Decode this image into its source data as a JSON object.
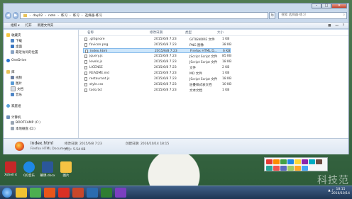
{
  "address": {
    "back_glyph": "◀",
    "forward_glyph": "▶",
    "crumbs": [
      "day02",
      "note",
      "练习",
      "练习",
      "选择器-练习"
    ],
    "search_placeholder": "搜索 选择器-练习",
    "refresh_glyph": "↻"
  },
  "toolbar": {
    "organize": "组织 ▾",
    "open": "打开",
    "new_folder": "新建文件夹"
  },
  "window_controls": {
    "min": "–",
    "max": "□",
    "close": "✕"
  },
  "nav": {
    "favorites": "收藏夹",
    "downloads": "下载",
    "desktop": "桌面",
    "recent": "最近访问的位置",
    "onedrive": "OneDrive",
    "libraries": "库",
    "videos": "视频",
    "pictures": "图片",
    "documents": "文档",
    "music": "音乐",
    "homegroup": "家庭组",
    "computer": "计算机",
    "bootcamp": "BOOTCAMP (C:)",
    "local_disk": "本地磁盘 (D:)"
  },
  "columns": {
    "name": "名称",
    "date": "修改日期",
    "type": "类型",
    "size": "大小"
  },
  "files": [
    {
      "name": ".gitignore",
      "date": "2015/6/8 7:23",
      "type": "GITIGNORE 文件",
      "size": "1 KB"
    },
    {
      "name": "favicon.png",
      "date": "2015/6/8 7:23",
      "type": "PNG 图像",
      "size": "38 KB"
    },
    {
      "name": "index.html",
      "date": "2015/6/8 7:23",
      "type": "Firefox HTML D...",
      "size": "6 KB"
    },
    {
      "name": "jquery.js",
      "date": "2015/6/8 7:23",
      "type": "JScript Script 文件",
      "size": "85 KB"
    },
    {
      "name": "levels.js",
      "date": "2015/6/8 7:23",
      "type": "JScript Script 文件",
      "size": "18 KB"
    },
    {
      "name": "LICENSE",
      "date": "2015/6/8 7:23",
      "type": "文件",
      "size": "2 KB"
    },
    {
      "name": "README.md",
      "date": "2015/6/8 7:23",
      "type": "MD 文件",
      "size": "1 KB"
    },
    {
      "name": "restaurant.js",
      "date": "2015/6/8 7:23",
      "type": "JScript Script 文件",
      "size": "18 KB"
    },
    {
      "name": "style.css",
      "date": "2015/6/8 7:23",
      "type": "层叠样式表文档",
      "size": "10 KB"
    },
    {
      "name": "todo.txt",
      "date": "2015/6/8 7:23",
      "type": "文本文档",
      "size": "1 KB"
    }
  ],
  "details": {
    "name": "index.html",
    "type": "Firefox HTML Document",
    "modified_label": "修改日期: 2015/6/8 7:23",
    "size_label": "大小: 5.54 KB",
    "created_label": "创建日期: 2016/10/14 18:15"
  },
  "desktop_icons": [
    {
      "label": "Xshell 4",
      "color": "#c62828"
    },
    {
      "label": "QQ音乐",
      "color": "#1e88e5"
    },
    {
      "label": "幕课.docx",
      "color": "#2b579a"
    },
    {
      "label": "图片",
      "color": "#f6c343"
    }
  ],
  "watermark": "科技范",
  "taskbar": {
    "apps": [
      {
        "name": "explorer",
        "color": "#f1c232"
      },
      {
        "name": "chrome",
        "color": "#4caf50"
      },
      {
        "name": "firefox",
        "color": "#e8561b"
      },
      {
        "name": "app-red",
        "color": "#d93025"
      },
      {
        "name": "powerpoint",
        "color": "#c8472b"
      },
      {
        "name": "app-blue",
        "color": "#2b6cb0"
      },
      {
        "name": "app-green",
        "color": "#2e7d32"
      },
      {
        "name": "app-purple",
        "color": "#7b3fbf"
      }
    ],
    "clock_time": "18:15",
    "clock_date": "2016/10/14",
    "tray_text": "▲ ♪"
  }
}
